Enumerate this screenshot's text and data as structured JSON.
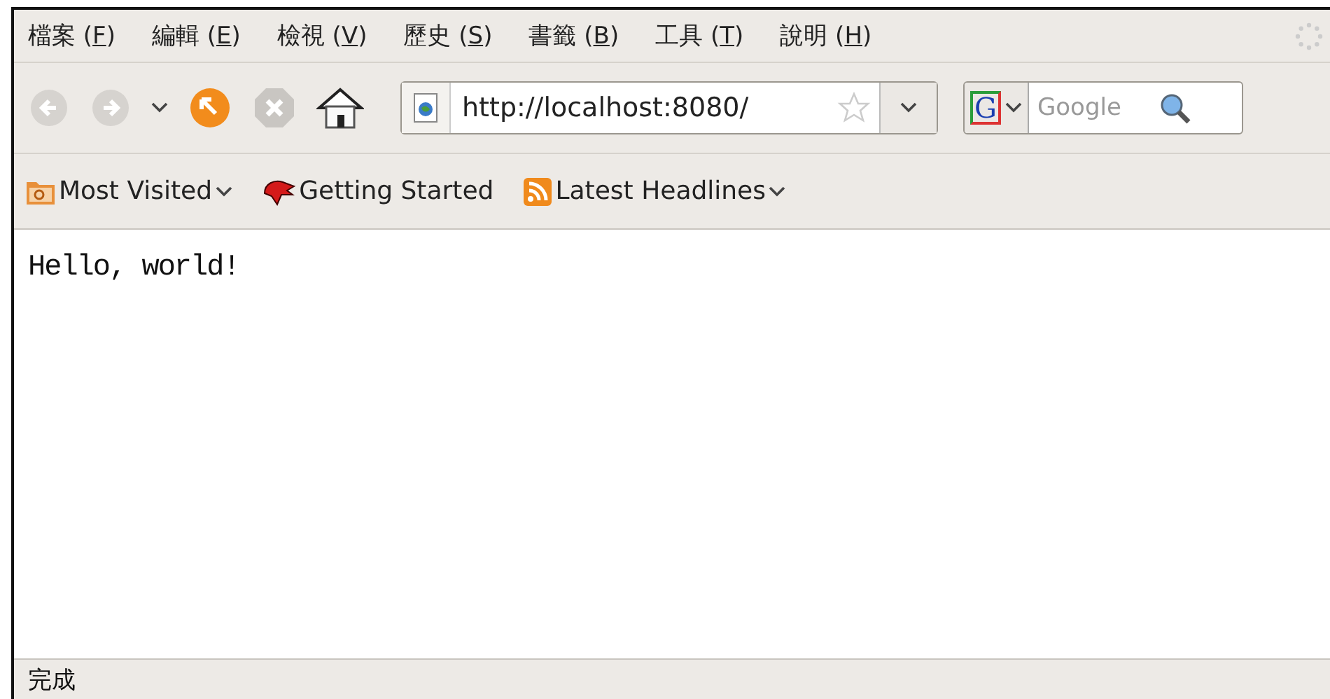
{
  "menu": [
    {
      "label": "檔案 (",
      "accesskey": "F",
      "label_end": ")"
    },
    {
      "label": "編輯 (",
      "accesskey": "E",
      "label_end": ")"
    },
    {
      "label": "檢視 (",
      "accesskey": "V",
      "label_end": ")"
    },
    {
      "label": "歷史 (",
      "accesskey": "S",
      "label_end": ")"
    },
    {
      "label": "書籤 (",
      "accesskey": "B",
      "label_end": ")"
    },
    {
      "label": "工具 (",
      "accesskey": "T",
      "label_end": ")"
    },
    {
      "label": "說明 (",
      "accesskey": "H",
      "label_end": ")"
    }
  ],
  "navigation": {
    "back_disabled": true,
    "forward_disabled": true,
    "stop_disabled": true
  },
  "address": {
    "value": "http://localhost:8080/"
  },
  "search": {
    "engine": "G",
    "placeholder": "Google"
  },
  "bookmarks": [
    {
      "kind": "folder",
      "label": "Most Visited",
      "dropdown": true
    },
    {
      "kind": "page",
      "label": "Getting Started",
      "dropdown": false
    },
    {
      "kind": "feed",
      "label": "Latest Headlines",
      "dropdown": true
    }
  ],
  "content": {
    "text": "Hello, world!"
  },
  "status_bar": {
    "text": "完成"
  }
}
